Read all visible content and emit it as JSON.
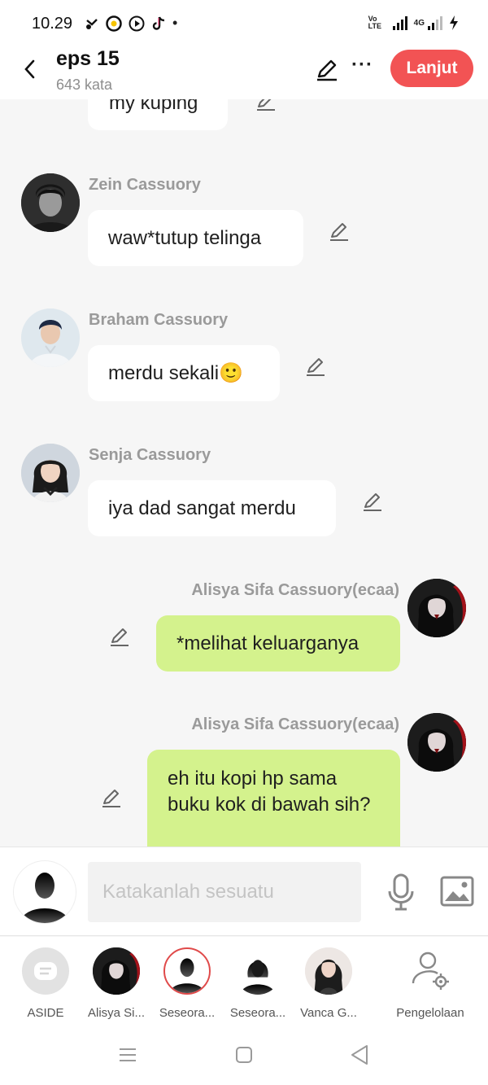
{
  "status_bar": {
    "time": "10.29",
    "dot": "•",
    "network_volte": "Vo LTE",
    "network_4g": "4G"
  },
  "header": {
    "title": "eps 15",
    "word_count": "643 kata",
    "next_label": "Lanjut"
  },
  "messages": [
    {
      "side": "left",
      "speaker": "",
      "text": "my kuping"
    },
    {
      "side": "left",
      "speaker": "Zein Cassuory",
      "text": "waw*tutup telinga"
    },
    {
      "side": "left",
      "speaker": "Braham Cassuory",
      "text": "merdu sekali🙂"
    },
    {
      "side": "left",
      "speaker": "Senja Cassuory",
      "text": "iya dad sangat merdu"
    },
    {
      "side": "right",
      "speaker": "Alisya Sifa Cassuory(ecaa)",
      "text": "*melihat keluarganya"
    },
    {
      "side": "right",
      "speaker": "Alisya Sifa Cassuory(ecaa)",
      "text": "eh itu kopi hp sama buku kok di bawah sih?"
    }
  ],
  "input": {
    "placeholder": "Katakanlah sesuatu"
  },
  "characters": [
    {
      "label": "ASIDE"
    },
    {
      "label": "Alisya Si..."
    },
    {
      "label": "Seseora..."
    },
    {
      "label": "Seseora..."
    },
    {
      "label": "Vanca G..."
    },
    {
      "label": "Pengelolaan"
    }
  ],
  "colors": {
    "accent": "#f25354",
    "right_bubble": "#d4f28d",
    "left_bubble": "#ffffff",
    "background": "#f6f6f6"
  }
}
